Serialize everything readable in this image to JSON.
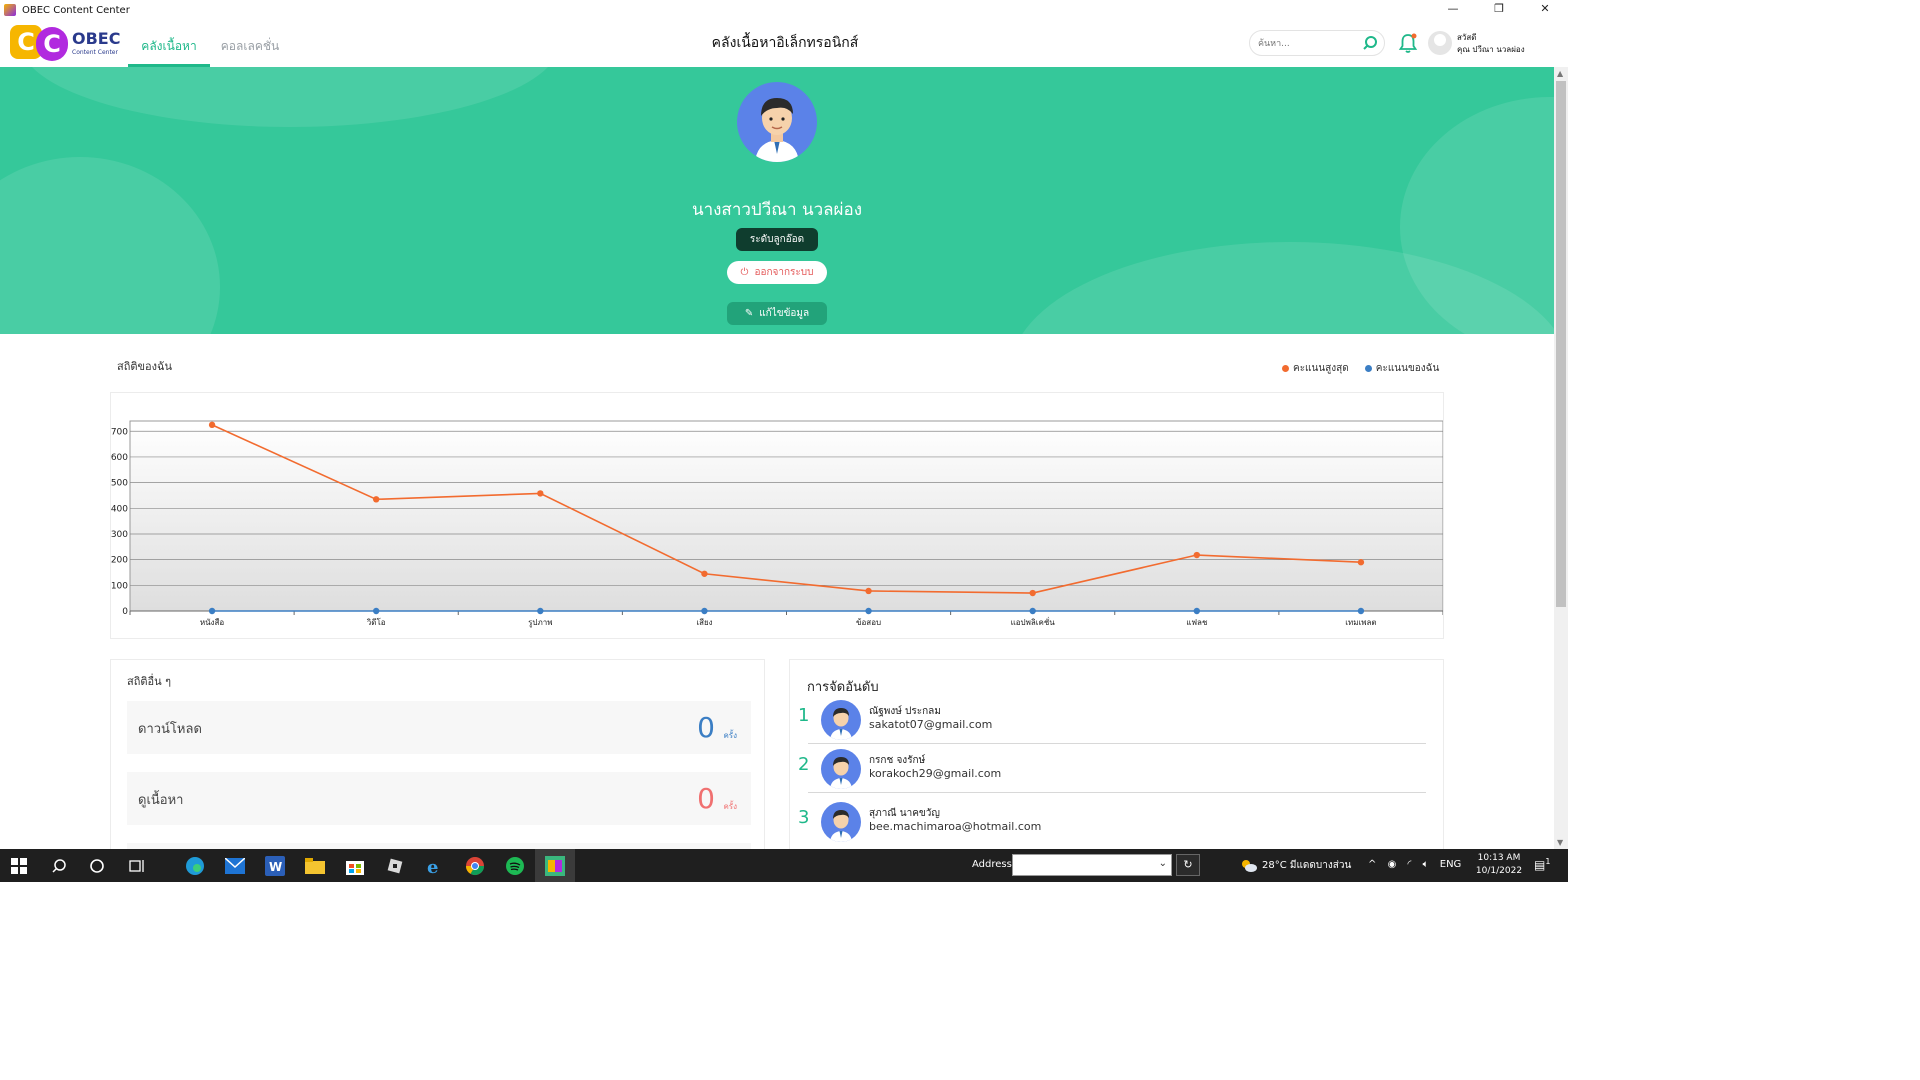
{
  "window": {
    "title": "OBEC Content Center",
    "minimize": "—",
    "maximize": "❐",
    "close": "✕"
  },
  "logo": {
    "c1": "C",
    "c2": "C",
    "name": "OBEC",
    "sub": "Content Center"
  },
  "nav": {
    "tab_content": "คลังเนื้อหา",
    "tab_collection": "คอลเลคชั่น"
  },
  "header": {
    "title": "คลังเนื้อหาอิเล็กทรอนิกส์"
  },
  "search": {
    "placeholder": "ค้นหา..."
  },
  "user": {
    "greeting": "สวัสดี",
    "name": "คุณ ปวีณา นวลผ่อง"
  },
  "profile": {
    "name": "นางสาวปวีณา นวลผ่อง",
    "level": "ระดับลูกอ๊อด",
    "logout": "ออกจากระบบ",
    "edit": "แก้ไขข้อมูล"
  },
  "stats": {
    "title": "สถิติของฉัน",
    "legend_max": "คะแนนสูงสุด",
    "legend_mine": "คะแนนของฉัน"
  },
  "colors": {
    "max_series": "#f26b2f",
    "my_series": "#3b7ec4",
    "accent": "#1fb88a",
    "hero": "#35c89a"
  },
  "chart_data": {
    "type": "line",
    "categories": [
      "หนังสือ",
      "วิดีโอ",
      "รูปภาพ",
      "เสียง",
      "ข้อสอบ",
      "แอปพลิเคชั่น",
      "แฟลช",
      "เทมเพลต"
    ],
    "series": [
      {
        "name": "คะแนนสูงสุด",
        "values": [
          725,
          435,
          458,
          145,
          78,
          70,
          218,
          190
        ]
      },
      {
        "name": "คะแนนของฉัน",
        "values": [
          0,
          0,
          0,
          0,
          0,
          0,
          0,
          0
        ]
      }
    ],
    "yticks": [
      0,
      100,
      200,
      300,
      400,
      500,
      600,
      700
    ],
    "ylim": [
      0,
      740
    ],
    "legend_position": "top-right",
    "grid": true
  },
  "other_stats": {
    "title": "สถิติอื่น ๆ",
    "rows": [
      {
        "label": "ดาวน์โหลด",
        "value": "0",
        "unit": "ครั้ง",
        "color": "#3b7ec4"
      },
      {
        "label": "ดูเนื้อหา",
        "value": "0",
        "unit": "ครั้ง",
        "color": "#f07070"
      }
    ]
  },
  "ranking": {
    "title": "การจัดอันดับ",
    "items": [
      {
        "rank": "1",
        "name": "ณัฐพงษ์ ประกลม",
        "email": "sakatot07@gmail.com"
      },
      {
        "rank": "2",
        "name": "กรกช จงรักษ์",
        "email": "korakoch29@gmail.com"
      },
      {
        "rank": "3",
        "name": "สุภาณี นาคขวัญ",
        "email": "bee.machimaroa@hotmail.com"
      }
    ]
  },
  "taskbar": {
    "address_label": "Address",
    "refresh": "↻",
    "weather": "28°C มีแดดบางส่วน",
    "lang": "ENG",
    "time": "10:13 AM",
    "date": "10/1/2022",
    "notifications": "1"
  }
}
